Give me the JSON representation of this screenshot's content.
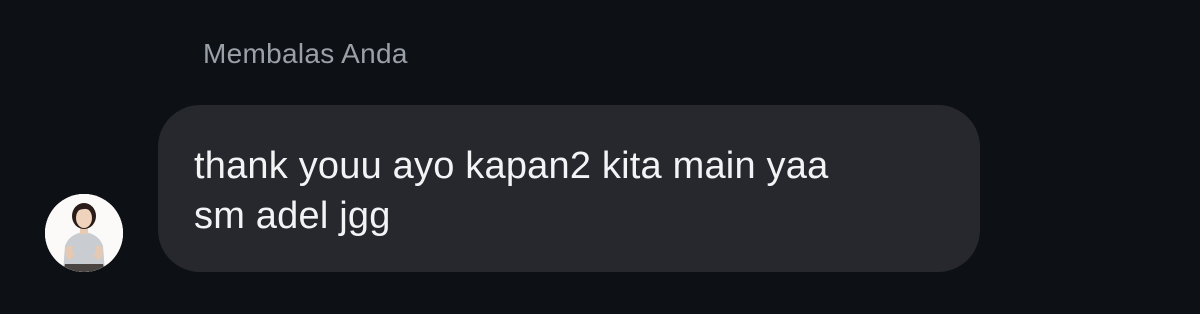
{
  "reply": {
    "label": "Membalas Anda"
  },
  "message": {
    "text": "thank youu ayo kapan2 kita main yaa\nsm adel jgg"
  },
  "sender": {
    "avatar_icon": "profile-photo"
  },
  "colors": {
    "background": "#0d1015",
    "bubble": "#26282d",
    "label": "#9aa0a8",
    "text": "#f2f3f5"
  }
}
